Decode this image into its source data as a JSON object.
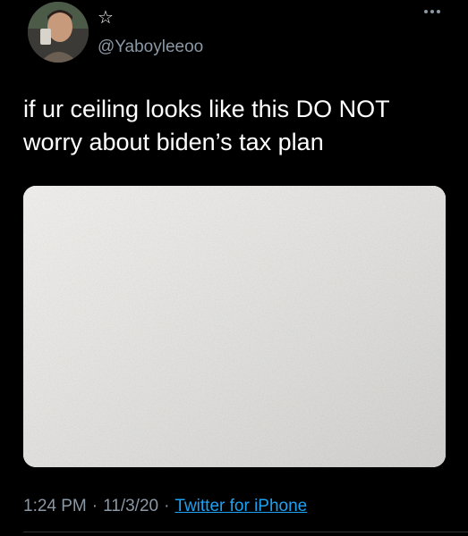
{
  "tweet": {
    "display_name": "☆",
    "handle": "@Yaboyleeoo",
    "text": "if ur ceiling looks like this DO NOT worry about biden’s tax plan",
    "time": "1:24 PM",
    "separator": "·",
    "date": "11/3/20",
    "source": "Twitter for iPhone"
  },
  "icons": {
    "more": "more-horizontal-icon",
    "avatar": "avatar-photo"
  },
  "colors": {
    "background": "#000000",
    "text": "#ffffff",
    "secondary_text": "#8b98a5",
    "link": "#1da1f2",
    "ceiling": "#c9c8c3"
  }
}
